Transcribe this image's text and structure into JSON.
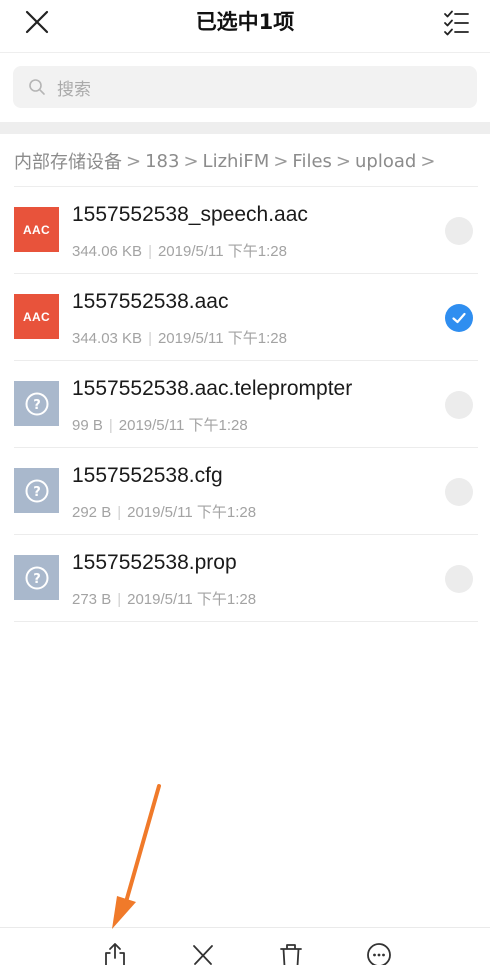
{
  "header": {
    "title": "已选中1项",
    "close_icon": "close-icon",
    "select_all_icon": "select-all-icon"
  },
  "search": {
    "placeholder": "搜索"
  },
  "breadcrumb": {
    "items": [
      "内部存储设备",
      "183",
      "LizhiFM",
      "Files",
      "upload"
    ],
    "separator": ">"
  },
  "files": [
    {
      "name": "1557552538_speech.aac",
      "size": "344.06 KB",
      "date": "2019/5/11 下午1:28",
      "type": "aac",
      "badge": "AAC",
      "selected": false
    },
    {
      "name": "1557552538.aac",
      "size": "344.03 KB",
      "date": "2019/5/11 下午1:28",
      "type": "aac",
      "badge": "AAC",
      "selected": true
    },
    {
      "name": "1557552538.aac.teleprompter",
      "size": "99 B",
      "date": "2019/5/11 下午1:28",
      "type": "unknown",
      "badge": "?",
      "selected": false
    },
    {
      "name": "1557552538.cfg",
      "size": "292 B",
      "date": "2019/5/11 下午1:28",
      "type": "unknown",
      "badge": "?",
      "selected": false
    },
    {
      "name": "1557552538.prop",
      "size": "273 B",
      "date": "2019/5/11 下午1:28",
      "type": "unknown",
      "badge": "?",
      "selected": false
    }
  ],
  "toolbar": {
    "icons": [
      "share-icon",
      "cut-icon",
      "delete-icon",
      "more-icon"
    ]
  },
  "colors": {
    "accent": "#2f8ef0",
    "aac_badge": "#e8533b",
    "unknown_badge": "#a9b8cc",
    "annotation_arrow": "#f07a2a"
  }
}
